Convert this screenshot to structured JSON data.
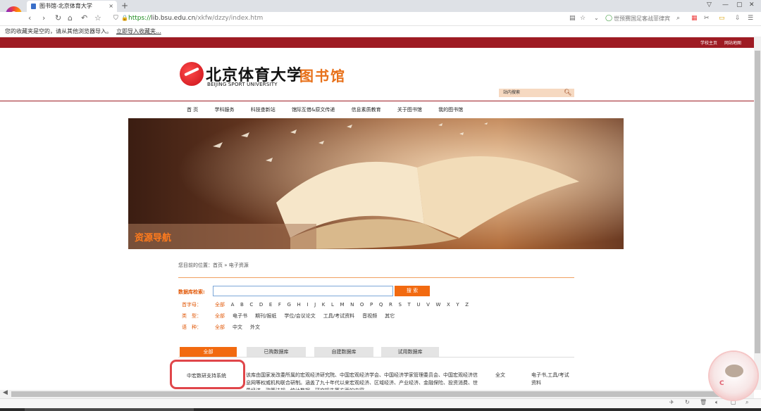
{
  "browser": {
    "tab_title": "图书馆-北京体育大学",
    "tab_close": "×",
    "new_tab": "+",
    "url_scheme": "https://",
    "url_host": "lib.bsu.edu.cn",
    "url_path": "/xkfw/dzzy/index.htm",
    "search_hint": "世预赛国足客战菲律宾",
    "bookmark_notice": "您的收藏夹是空的，请从其他浏览器导入。",
    "bookmark_import_link": "立即导入收藏夹..."
  },
  "site": {
    "top_links": [
      "学校主页",
      "网站地图"
    ],
    "logo_cn": "北京体育大学",
    "logo_en": "BEIJING SPORT UNIVERSITY",
    "library_title": "图书馆",
    "search_placeholder": "站内搜索",
    "menu": [
      "首 页",
      "学科服务",
      "科技查新站",
      "馆际互借&原文传递",
      "信息素质教育",
      "关于图书馆",
      "我的图书馆"
    ],
    "banner_title": "资源导航"
  },
  "content": {
    "breadcrumb": "您目前的位置：首页 » 电子资源",
    "db_search_label": "数据库检索:",
    "db_search_button": "搜 索",
    "initial_label": "首字母：",
    "initial_all": "全部",
    "letters": [
      "A",
      "B",
      "C",
      "D",
      "E",
      "F",
      "G",
      "H",
      "I",
      "J",
      "K",
      "L",
      "M",
      "N",
      "O",
      "P",
      "Q",
      "R",
      "S",
      "T",
      "U",
      "V",
      "W",
      "X",
      "Y",
      "Z"
    ],
    "type_label": "类　型：",
    "type_all": "全部",
    "types": [
      "电子书",
      "期刊/报纸",
      "学位/会议论文",
      "工具/考试资料",
      "音视频",
      "其它"
    ],
    "lang_label": "语　种：",
    "lang_all": "全部",
    "langs": [
      "中文",
      "外文"
    ],
    "tabs": [
      "全部",
      "已购数据库",
      "自建数据库",
      "试用数据库"
    ],
    "item_name": "中宏数研支持系统",
    "item_desc": "该库由国家发改委所属的宏观经济研究院、中国宏观经济学会、中国经济学家管理委员会、中国宏观经济信息网等权威机构联合研制。涵盖了九十年代以来宏观经济、区域经济、产业经济、金融保险、投资消费、世界经济、政策法规、统计数据、研究报告等方面的内容",
    "item_fulltext": "全文",
    "item_category": "电子书,工具/考试资料"
  },
  "colors": {
    "accent_red": "#9e1b23",
    "accent_orange": "#f26a10",
    "highlight_box": "#e0464a"
  }
}
